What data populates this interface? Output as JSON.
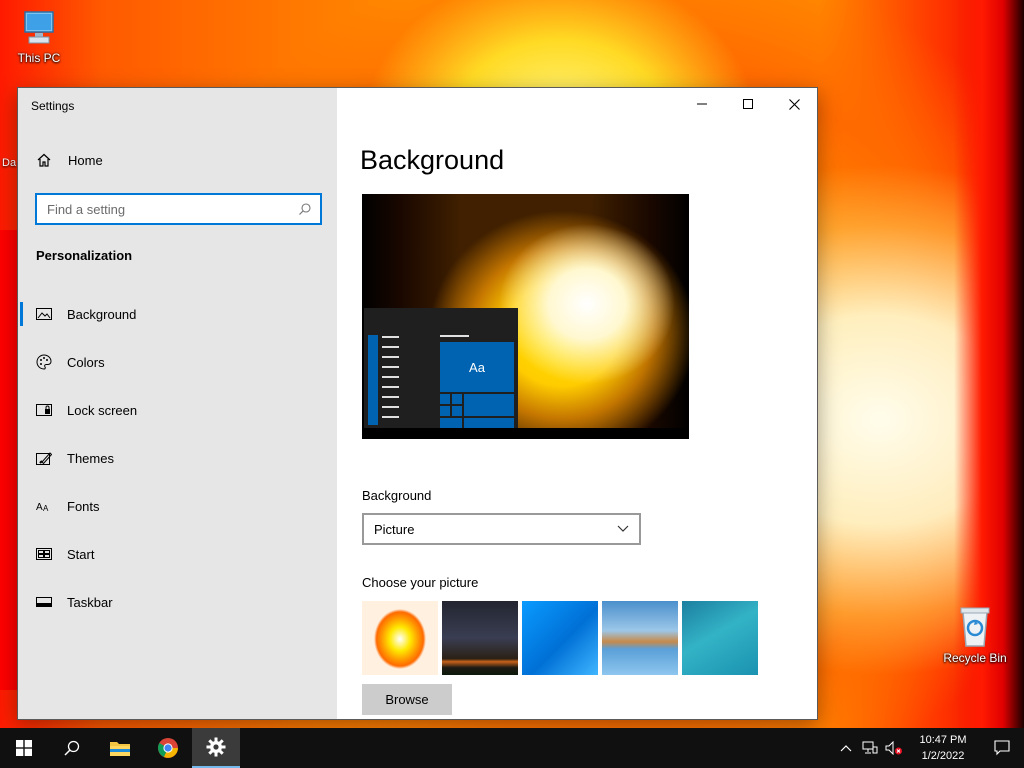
{
  "desktop": {
    "icons": [
      {
        "label": "This PC"
      },
      {
        "label": "Recycle Bin"
      }
    ],
    "partial_label": "Da"
  },
  "window": {
    "title": "Settings",
    "sidebar": {
      "home_label": "Home",
      "search_placeholder": "Find a setting",
      "section_heading": "Personalization",
      "items": [
        {
          "label": "Background",
          "icon": "picture-icon",
          "active": true
        },
        {
          "label": "Colors",
          "icon": "palette-icon",
          "active": false
        },
        {
          "label": "Lock screen",
          "icon": "lock-screen-icon",
          "active": false
        },
        {
          "label": "Themes",
          "icon": "themes-icon",
          "active": false
        },
        {
          "label": "Fonts",
          "icon": "fonts-icon",
          "active": false
        },
        {
          "label": "Start",
          "icon": "start-icon",
          "active": false
        },
        {
          "label": "Taskbar",
          "icon": "taskbar-icon",
          "active": false
        }
      ]
    },
    "content": {
      "page_title": "Background",
      "preview_tile_text": "Aa",
      "background_label": "Background",
      "background_value": "Picture",
      "choose_label": "Choose your picture",
      "thumbnails": [
        "fire-explosion",
        "night-sky",
        "windows-blue",
        "beach-rocks",
        "underwater-swimmer"
      ],
      "browse_label": "Browse"
    }
  },
  "taskbar": {
    "apps": [
      "start-icon",
      "search-icon",
      "file-explorer-icon",
      "chrome-icon",
      "settings-icon"
    ],
    "active_app": "settings-icon",
    "time": "10:47 PM",
    "date": "1/2/2022"
  },
  "colors": {
    "accent": "#0078d7",
    "sidebar_bg": "#e6e6e6",
    "taskbar_bg": "#101010"
  }
}
